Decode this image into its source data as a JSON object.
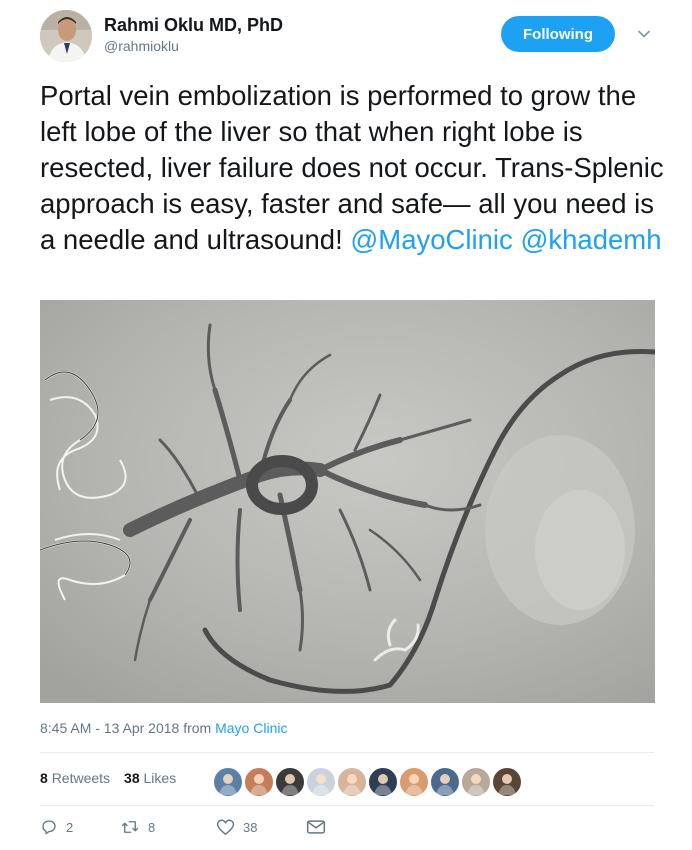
{
  "author": {
    "name": "Rahmi Oklu MD, PhD",
    "handle": "@rahmioklu"
  },
  "follow_button": "Following",
  "tweet": {
    "text": "Portal vein embolization is performed to grow the left lobe of the liver so that when right lobe is resected, liver failure does not occur. Trans-Splenic approach is easy, faster and safe— all you need is a needle and ultrasound! ",
    "mention_1": "@MayoClinic",
    "mention_2": "@khademh"
  },
  "meta": {
    "timestamp": "8:45 AM - 13 Apr 2018 from ",
    "source": "Mayo Clinic"
  },
  "stats": {
    "retweets_count": "8",
    "retweets_label": "Retweets",
    "likes_count": "38",
    "likes_label": "Likes"
  },
  "liker_colors": [
    "#5b7fa6",
    "#c47e5a",
    "#3b3b3b",
    "#c9d3de",
    "#d7b49a",
    "#2f3e55",
    "#d99c6e",
    "#4c6a8e",
    "#b7a89a",
    "#5a4636"
  ],
  "actions": {
    "reply_count": "2",
    "retweet_count": "8",
    "like_count": "38"
  },
  "colors": {
    "accent": "#1da1f2",
    "text": "#14171a",
    "muted": "#657786"
  }
}
